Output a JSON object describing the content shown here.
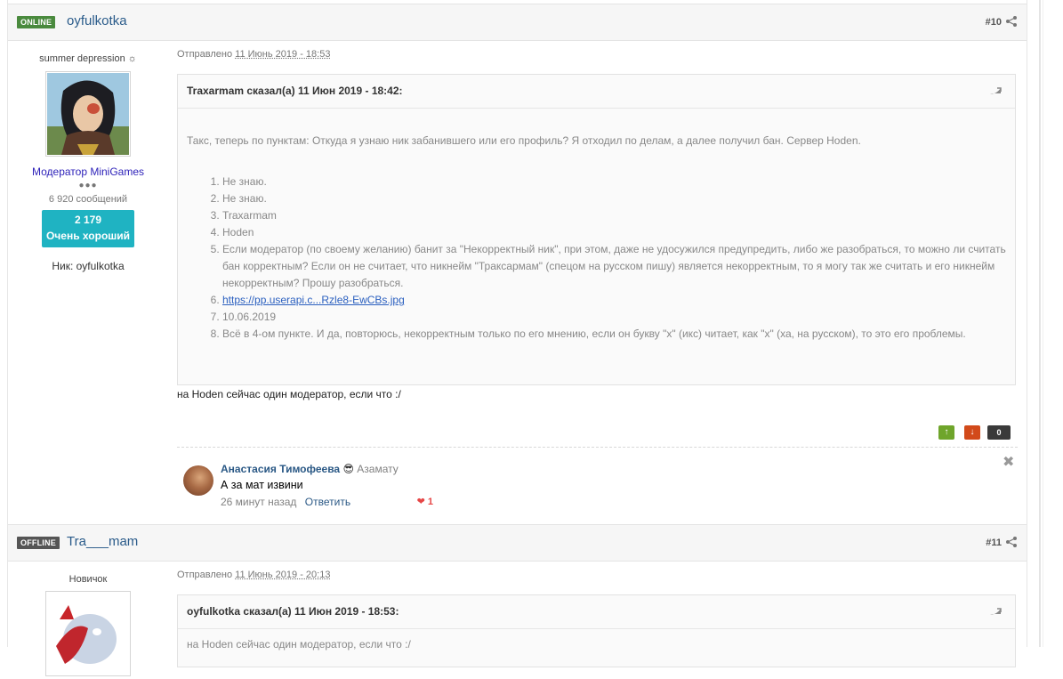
{
  "post1": {
    "status": "ONLINE",
    "author": "oyfulkotka",
    "number": "#10",
    "user_title": "summer depression ☼",
    "group": "Модератор MiniGames",
    "pips": "●●●",
    "post_count": "6 920 сообщений",
    "rep_value": "2 179",
    "rep_label": "Очень хороший",
    "nick": "Ник: oyfulkotka",
    "sent_prefix": "Отправлено",
    "sent_date": "11 Июнь 2019 - 18:53",
    "quote_header": "Traxarmam сказал(а) 11 Июн 2019 - 18:42:",
    "quote_intro": "Такс, теперь по пунктам: Откуда я узнаю ник забанившего или его профиль? Я отходил по делам, а далее получил бан. Сервер Hoden.",
    "quote_items": [
      "Не знаю.",
      "Не знаю.",
      "Traxarmam",
      "Hoden",
      "Если модератор (по своему желанию) банит за \"Некорректный ник\", при этом, даже не удосужился предупредить, либо же разобраться, то можно ли считать бан корректным? Если он не считает, что никнейм \"Траксармам\" (спецом на русском пишу) является некорректным, то я могу так же считать и его никнейм некорректным? Прошу разобраться.",
      "https://pp.userapi.c...Rzle8-EwCBs.jpg",
      "10.06.2019",
      "Всё в 4-ом пункте. И да, повторюсь, некорректным только по его мнению, если он букву \"х\" (икс) читает, как \"х\" (ха, на русском), то это его проблемы."
    ],
    "text": "на Hoden сейчас один модератор, если что :/",
    "vote_up": "↑",
    "vote_down": "↓",
    "vote_count": "0"
  },
  "comment": {
    "name": "Анастасия Тимофеева",
    "emoji": "😎",
    "to": "Азамату",
    "text": "А за мат извини",
    "time": "26 минут назад",
    "reply": "Ответить",
    "likes": "1",
    "close": "✖"
  },
  "post2": {
    "status": "OFFLINE",
    "author": "Tra___mam",
    "number": "#11",
    "user_title": "Новичок",
    "sent_prefix": "Отправлено",
    "sent_date": "11 Июнь 2019 - 20:13",
    "quote_header": "oyfulkotka сказал(а) 11 Июн 2019 - 18:53:",
    "quote_preview": "на Hoden сейчас один модератор, если что :/"
  }
}
